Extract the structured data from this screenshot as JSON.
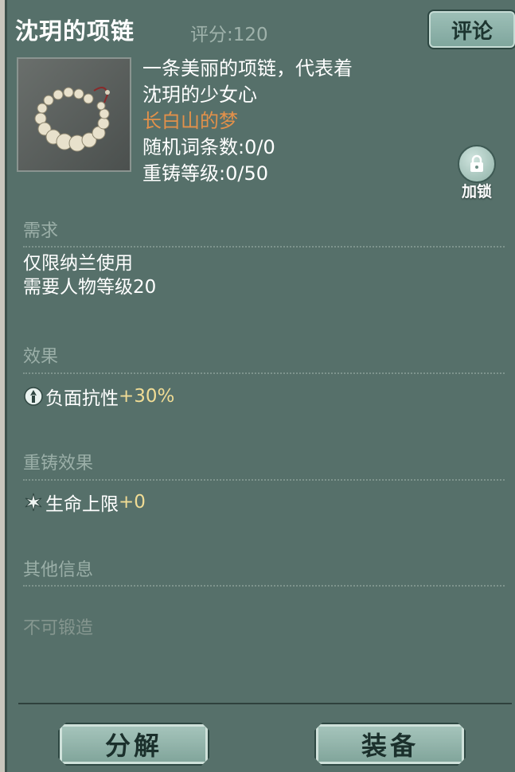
{
  "item": {
    "name": "沈玥的项链",
    "score": "评分:120",
    "description_lines": [
      "一条美丽的项链，代表着",
      "沈玥的少女心"
    ],
    "set_name": "长白山的梦",
    "random_affix": "随机词条数:0/0",
    "reforge_level": "重铸等级:0/50"
  },
  "buttons": {
    "comment": "评论",
    "lock": "加锁",
    "decompose": "分解",
    "equip": "装备"
  },
  "sections": {
    "requirements": {
      "title": "需求",
      "lines": [
        "仅限纳兰使用",
        "需要人物等级20"
      ]
    },
    "effects": {
      "title": "效果",
      "stat_name": "负面抗性",
      "stat_value": "+30%"
    },
    "reforge_effects": {
      "title": "重铸效果",
      "stat_name": "生命上限",
      "stat_value": "+0"
    },
    "other_info": {
      "title": "其他信息",
      "note": "不可锻造"
    }
  },
  "colors": {
    "panel_bg": "#56706a",
    "set_name": "#e3914a",
    "stat_value": "#f0dc95",
    "section_title": "#9bafa8"
  },
  "icons": {
    "item_thumbnail": "pearl-necklace-icon",
    "lock": "lock-icon",
    "effect": "resistance-icon",
    "reforge": "star-burst-icon"
  }
}
